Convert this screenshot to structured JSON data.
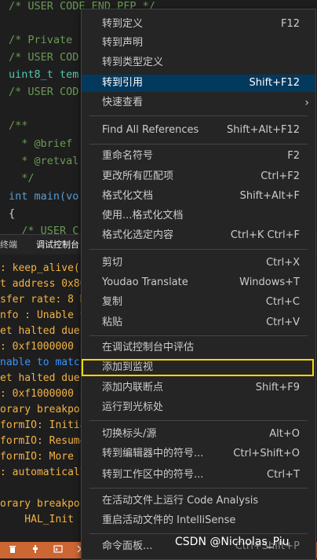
{
  "editor": {
    "lines": [
      "/* USER CODE END PFP */",
      "/* Private",
      "/* USER COD",
      "uint8_t tem",
      "/* USER COD",
      "/**",
      "  * @brief",
      "  * @retval",
      "  */",
      "int main(vo",
      "{",
      "  /* USER C"
    ]
  },
  "panel": {
    "tabs": [
      "终端",
      "调试控制台"
    ]
  },
  "console": {
    "lines": [
      ": keep_alive(",
      "t address 0x80",
      "sfer rate: 8 K",
      "nfo : Unable t",
      "et halted due",
      ": 0xf1000000 p",
      "nable to match",
      "et halted due",
      ": 0xf1000000 p",
      "orary breakpoi",
      "formIO: Initia",
      "formIO: Resume",
      "formIO: More c",
      ": automaticall",
      "",
      "orary breakpoi",
      "    HAL_Init"
    ]
  },
  "context_menu": {
    "items": [
      {
        "label": "转到定义",
        "shortcut": "F12"
      },
      {
        "label": "转到声明",
        "shortcut": ""
      },
      {
        "label": "转到类型定义",
        "shortcut": ""
      },
      {
        "label": "转到引用",
        "shortcut": "Shift+F12"
      },
      {
        "label": "快速查看",
        "shortcut": ""
      },
      {
        "label": "Find All References",
        "shortcut": "Shift+Alt+F12"
      },
      {
        "label": "重命名符号",
        "shortcut": "F2"
      },
      {
        "label": "更改所有匹配项",
        "shortcut": "Ctrl+F2"
      },
      {
        "label": "格式化文档",
        "shortcut": "Shift+Alt+F"
      },
      {
        "label": "使用...格式化文档",
        "shortcut": ""
      },
      {
        "label": "格式化选定内容",
        "shortcut": "Ctrl+K Ctrl+F"
      },
      {
        "label": "剪切",
        "shortcut": "Ctrl+X"
      },
      {
        "label": "Youdao Translate",
        "shortcut": "Windows+T"
      },
      {
        "label": "复制",
        "shortcut": "Ctrl+C"
      },
      {
        "label": "粘贴",
        "shortcut": "Ctrl+V"
      },
      {
        "label": "在调试控制台中评估",
        "shortcut": ""
      },
      {
        "label": "添加到监视",
        "shortcut": ""
      },
      {
        "label": "添加内联断点",
        "shortcut": "Shift+F9"
      },
      {
        "label": "运行到光标处",
        "shortcut": ""
      },
      {
        "label": "切换标头/源",
        "shortcut": "Alt+O"
      },
      {
        "label": "转到编辑器中的符号...",
        "shortcut": "Ctrl+Shift+O"
      },
      {
        "label": "转到工作区中的符号...",
        "shortcut": "Ctrl+T"
      },
      {
        "label": "在活动文件上运行 Code Analysis",
        "shortcut": ""
      },
      {
        "label": "重启活动文件的 IntelliSense",
        "shortcut": ""
      },
      {
        "label": "命令面板...",
        "shortcut": "Ctrl+Shift+P"
      }
    ]
  },
  "watermark": "CSDN @Nicholas_Piu",
  "colors": {
    "menu_bg": "#252526",
    "selected_bg": "#04395e",
    "highlight_outline": "#ffd800",
    "statusbar_bg": "#cc6633",
    "console_text": "#f5b342"
  }
}
